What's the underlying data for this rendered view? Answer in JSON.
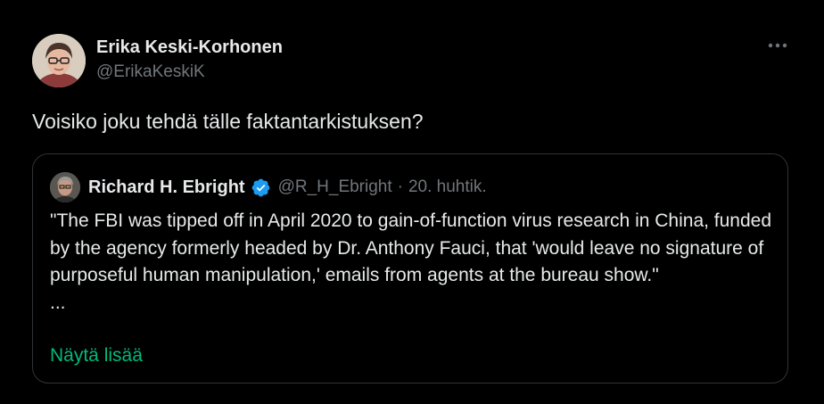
{
  "author": {
    "display_name": "Erika Keski-Korhonen",
    "handle": "@ErikaKeskiK",
    "avatar_icon": "user-avatar"
  },
  "menu": {
    "icon": "more-horizontal-icon"
  },
  "tweet": {
    "text": "Voisiko joku tehdä tälle faktantarkistuksen?"
  },
  "quote": {
    "display_name": "Richard H. Ebright",
    "verified_icon": "verified-badge-icon",
    "handle": "@R_H_Ebright",
    "separator": "·",
    "date": "20. huhtik.",
    "text": "\"The FBI was tipped off in April 2020 to gain-of-function virus research in China, funded by the agency formerly headed by Dr. Anthony Fauci, that 'would leave no signature of purposeful human manipulation,' emails from agents at the bureau show.\"\n...",
    "show_more": "Näytä lisää"
  },
  "colors": {
    "background": "#000000",
    "text_primary": "#e7e9ea",
    "text_secondary": "#71767b",
    "border": "#2f3336",
    "verified": "#1d9bf0",
    "link": "#00ba7c"
  }
}
